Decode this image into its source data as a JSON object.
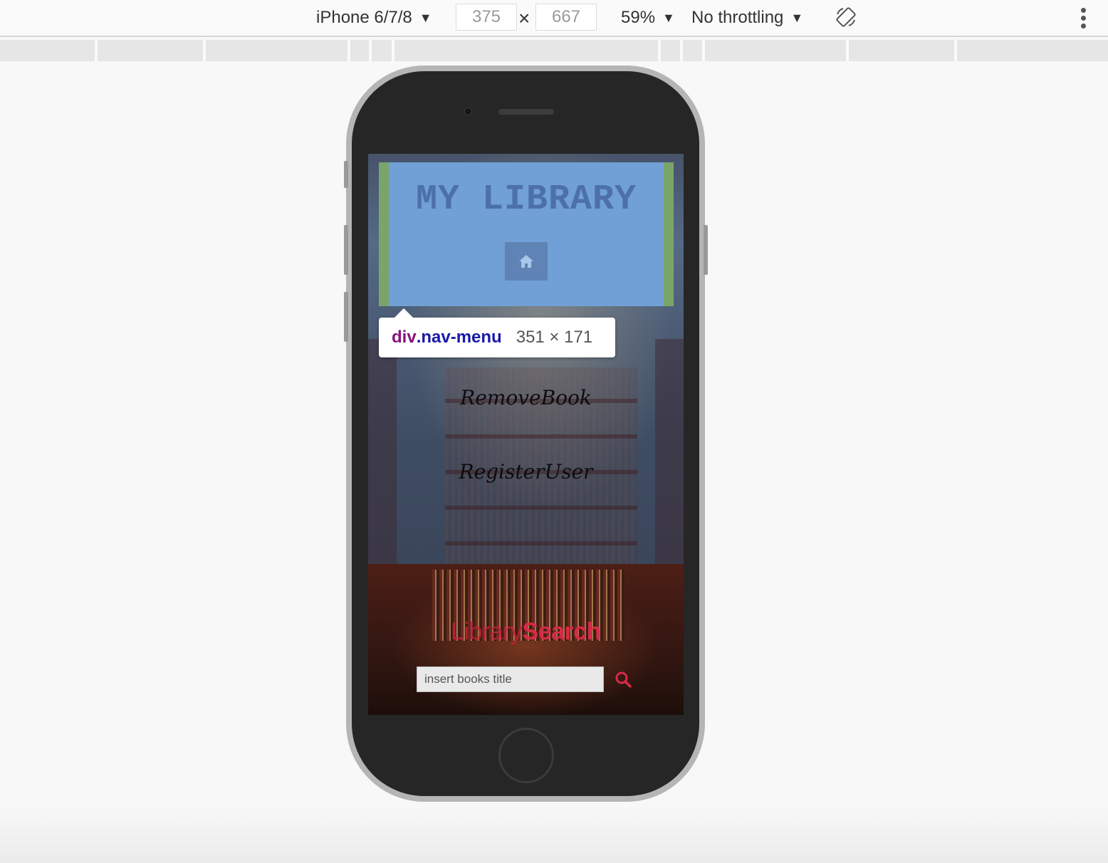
{
  "toolbar": {
    "device": "iPhone 6/7/8",
    "width": "375",
    "height": "667",
    "times": "×",
    "zoom": "59%",
    "throttling": "No throttling",
    "rotate_icon": "rotate-icon",
    "more_icon": "kebab-menu-icon"
  },
  "site": {
    "title": "MY LIBRARY",
    "home_icon": "home-icon",
    "nav_links": [
      "RemoveBook",
      "RegisterUser"
    ],
    "search_heading_part1": "Library",
    "search_heading_part2": "Search",
    "search_placeholder": "insert books title",
    "search_icon": "search-icon"
  },
  "inspector": {
    "tag": "div",
    "class": ".nav-menu",
    "size": "351 × 171"
  },
  "colors": {
    "accent_red": "#d82a47",
    "highlight_content": "#6fa0de",
    "highlight_margin": "#7aa56a"
  }
}
